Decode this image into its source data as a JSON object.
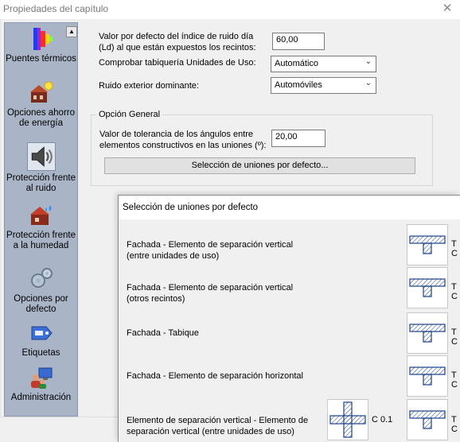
{
  "window": {
    "title": "Propiedades del capítulo",
    "close_glyph": "✕"
  },
  "sidebar": {
    "scroll_glyph": "▲",
    "items": [
      {
        "label": "Puentes térmicos",
        "icon": "thermal-bridge-icon"
      },
      {
        "label": "Opciones ahorro de energía",
        "icon": "energy-saving-icon"
      },
      {
        "label": "Protección frente al ruido",
        "icon": "speaker-icon",
        "selected": true
      },
      {
        "label": "Protección frente a la humedad",
        "icon": "humidity-icon"
      },
      {
        "label": "Opciones por defecto",
        "icon": "gears-icon"
      },
      {
        "label": "Etiquetas",
        "icon": "tag-icon"
      },
      {
        "label": "Administración",
        "icon": "admin-icon"
      }
    ]
  },
  "main": {
    "noise_index": {
      "label": "Valor por defecto del índice de ruido día (Ld) al que están expuestos los recintos:",
      "value": "60,00"
    },
    "partition_check": {
      "label": "Comprobar tabiquería Unidades de Uso:",
      "value": "Automático"
    },
    "exterior_noise": {
      "label": "Ruido exterior dominante:",
      "value": "Automóviles"
    },
    "general_group": {
      "legend": "Opción General",
      "tolerance": {
        "label": "Valor de tolerancia de los ángulos entre elementos constructivos en las uniones (º):",
        "value": "20,00"
      },
      "default_joints_button": "Selección de uniones por defecto..."
    }
  },
  "dialog": {
    "title": "Selección de uniones por defecto",
    "rows": [
      {
        "label": "Fachada - Elemento de separación vertical (entre unidades de uso)",
        "code_right": "T C"
      },
      {
        "label": "Fachada - Elemento de separación vertical (otros recintos)",
        "code_right": "T C"
      },
      {
        "label": "Fachada - Tabique",
        "code_right": "T C"
      },
      {
        "label": "Fachada - Elemento de separación horizontal",
        "code_right": "T C"
      },
      {
        "label": "Elemento de separación vertical - Elemento de separación vertical (entre unidades de uso)",
        "code_left": "C 0.1",
        "code_right": "T C"
      }
    ]
  }
}
